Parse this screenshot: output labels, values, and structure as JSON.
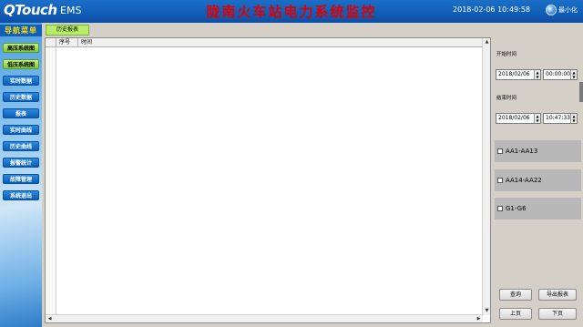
{
  "header": {
    "logo": "QTouch",
    "logo_sub": "EMS",
    "title": "陇南火车站电力系统监控",
    "datetime": "2018-02-06 10:49:58",
    "minimize_label": "最小化"
  },
  "sidebar": {
    "title": "导航菜单",
    "items": [
      {
        "label": "高压系统图"
      },
      {
        "label": "低压系统图"
      },
      {
        "label": "实时数据"
      },
      {
        "label": "历史数据"
      },
      {
        "label": "报表"
      },
      {
        "label": "实时曲线"
      },
      {
        "label": "历史曲线"
      },
      {
        "label": "报警统计"
      },
      {
        "label": "故障管理"
      },
      {
        "label": "系统退出"
      }
    ]
  },
  "tab": {
    "label": "历史报表"
  },
  "table": {
    "columns": [
      "序号",
      "时间"
    ]
  },
  "query": {
    "start_label": "开始时间",
    "start_date": "2018/02/06",
    "start_time": "00:00:00",
    "end_label": "结束时间",
    "end_date": "2018/02/06",
    "end_time": "10:47:33",
    "groups": [
      {
        "label": "AA1-AA13"
      },
      {
        "label": "AA14-AA22"
      },
      {
        "label": "G1-G6"
      }
    ],
    "buttons": {
      "query": "查询",
      "export": "导出报表",
      "prev": "上页",
      "next": "下页"
    }
  },
  "colors": {
    "header_bg": "#0b4fa8",
    "title_red": "#e00000",
    "tab_green": "#b6ec6a",
    "menu_blue": "#0a5cb5",
    "menu_green": "#7dc73a"
  }
}
